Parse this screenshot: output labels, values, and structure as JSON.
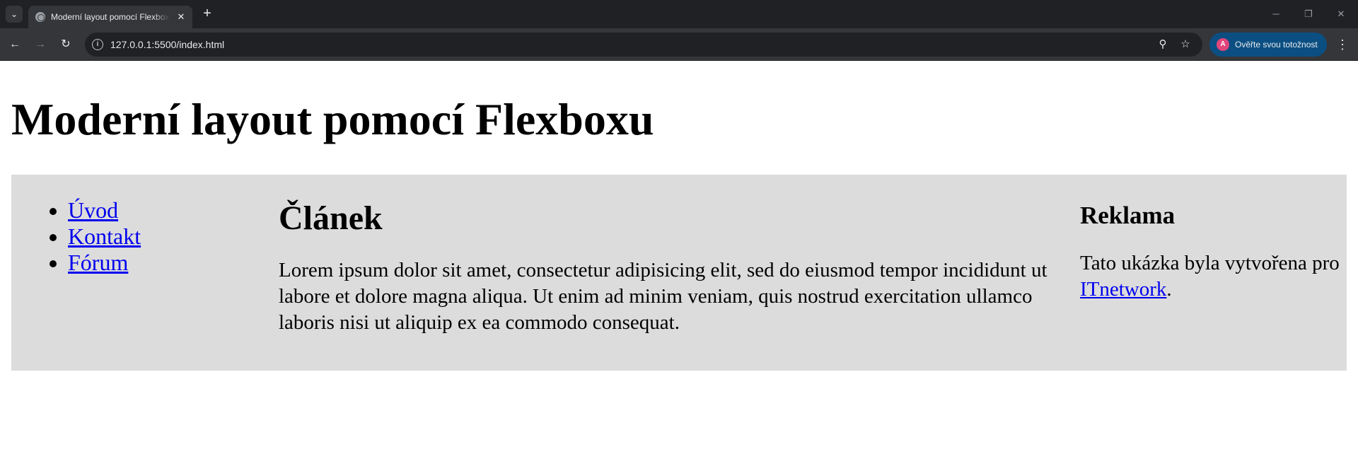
{
  "browser": {
    "tab": {
      "title": "Moderní layout pomocí Flexboxu"
    },
    "omnibox": {
      "url": "127.0.0.1:5500/index.html"
    },
    "profile": {
      "avatar_letter": "A",
      "label": "Ověřte svou totožnost",
      "color": "#0b4f82"
    }
  },
  "page": {
    "title": "Moderní layout pomocí Flexboxu",
    "nav": {
      "items": [
        "Úvod",
        "Kontakt",
        "Fórum"
      ]
    },
    "article": {
      "heading": "Článek",
      "text": "Lorem ipsum dolor sit amet, consectetur adipisicing elit, sed do eiusmod tempor incididunt ut labore et dolore magna aliqua. Ut enim ad minim veniam, quis nostrud exercitation ullamco laboris nisi ut aliquip ex ea commodo consequat."
    },
    "aside": {
      "heading": "Reklama",
      "text_before": "Tato ukázka byla vytvořena pro ",
      "link": "ITnetwork",
      "text_after": "."
    },
    "colors": {
      "container_bg": "#dcdcdc",
      "link": "#0000ee"
    }
  }
}
